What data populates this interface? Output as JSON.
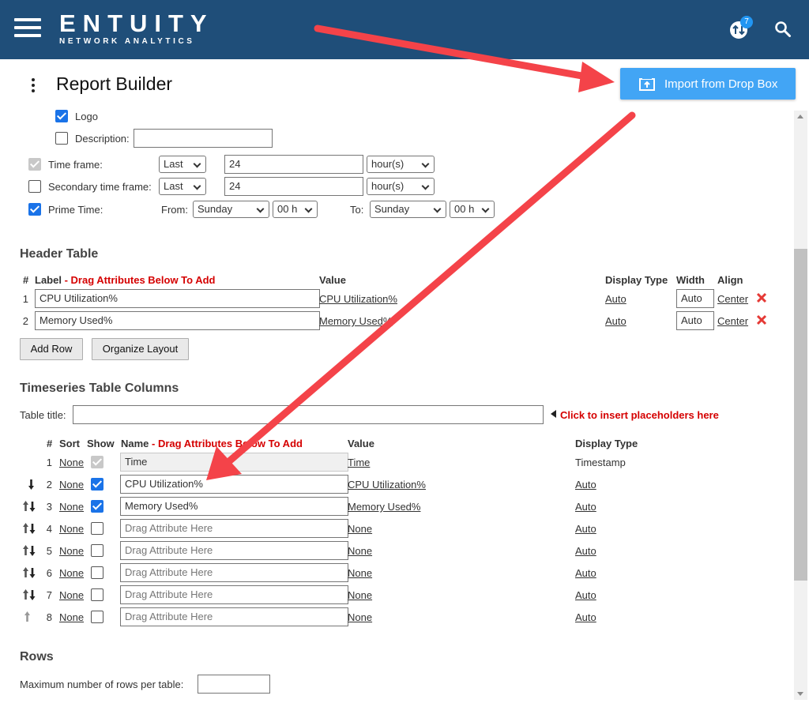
{
  "header": {
    "brand_name": "ENTUITY",
    "brand_tagline": "NETWORK ANALYTICS",
    "notification_count": "7",
    "color": "#1f4e79"
  },
  "page": {
    "title": "Report Builder",
    "import_button": "Import from Drop Box"
  },
  "options": {
    "logo_label": "Logo",
    "logo_checked": true,
    "description_label": "Description:",
    "description_value": "",
    "time_frame_label": "Time frame:",
    "time_frame_mode": "Last",
    "time_frame_value": "24",
    "time_frame_unit": "hour(s)",
    "secondary_label": "Secondary time frame:",
    "secondary_mode": "Last",
    "secondary_value": "24",
    "secondary_unit": "hour(s)",
    "prime_label": "Prime Time:",
    "from_label": "From:",
    "from_day": "Sunday",
    "from_hour": "00 h",
    "to_label": "To:",
    "to_day": "Sunday",
    "to_hour": "00 h"
  },
  "header_table": {
    "title": "Header Table",
    "col_hash": "#",
    "col_label": "Label",
    "col_label_hint": "- Drag Attributes Below To Add",
    "col_value": "Value",
    "col_display_type": "Display Type",
    "col_width": "Width",
    "col_align": "Align",
    "rows": [
      {
        "num": "1",
        "label": "CPU Utilization%",
        "value": "CPU Utilization%",
        "display_type": "Auto",
        "width": "Auto",
        "align": "Center"
      },
      {
        "num": "2",
        "label": "Memory Used%",
        "value": "Memory Used%",
        "display_type": "Auto",
        "width": "Auto",
        "align": "Center"
      }
    ],
    "add_row": "Add Row",
    "organize_layout": "Organize Layout"
  },
  "timeseries": {
    "title": "Timeseries Table Columns",
    "table_title_label": "Table title:",
    "table_title_value": "",
    "placeholder_hint": "Click to insert placeholders here",
    "col_hash": "#",
    "col_sort": "Sort",
    "col_show": "Show",
    "col_name": "Name",
    "col_name_hint": "- Drag Attributes Below To Add",
    "col_value": "Value",
    "col_display_type": "Display Type",
    "rows": [
      {
        "num": "1",
        "sort": "None",
        "name": "Time",
        "value": "Time",
        "display_type": "Timestamp"
      },
      {
        "num": "2",
        "sort": "None",
        "name": "CPU Utilization%",
        "value": "CPU Utilization%",
        "display_type": "Auto"
      },
      {
        "num": "3",
        "sort": "None",
        "name": "Memory Used%",
        "value": "Memory Used%",
        "display_type": "Auto"
      },
      {
        "num": "4",
        "sort": "None",
        "name": "Drag Attribute Here",
        "value": "None",
        "display_type": "Auto"
      },
      {
        "num": "5",
        "sort": "None",
        "name": "Drag Attribute Here",
        "value": "None",
        "display_type": "Auto"
      },
      {
        "num": "6",
        "sort": "None",
        "name": "Drag Attribute Here",
        "value": "None",
        "display_type": "Auto"
      },
      {
        "num": "7",
        "sort": "None",
        "name": "Drag Attribute Here",
        "value": "None",
        "display_type": "Auto"
      },
      {
        "num": "8",
        "sort": "None",
        "name": "Drag Attribute Here",
        "value": "None",
        "display_type": "Auto"
      }
    ]
  },
  "rows_section": {
    "title": "Rows",
    "max_rows_label": "Maximum number of rows per table:",
    "max_rows_value": ""
  },
  "colors": {
    "accent_blue": "#42a5f5",
    "checkbox_blue": "#1a73e8",
    "annotation_red": "#f44349",
    "hint_red": "#d50000"
  }
}
